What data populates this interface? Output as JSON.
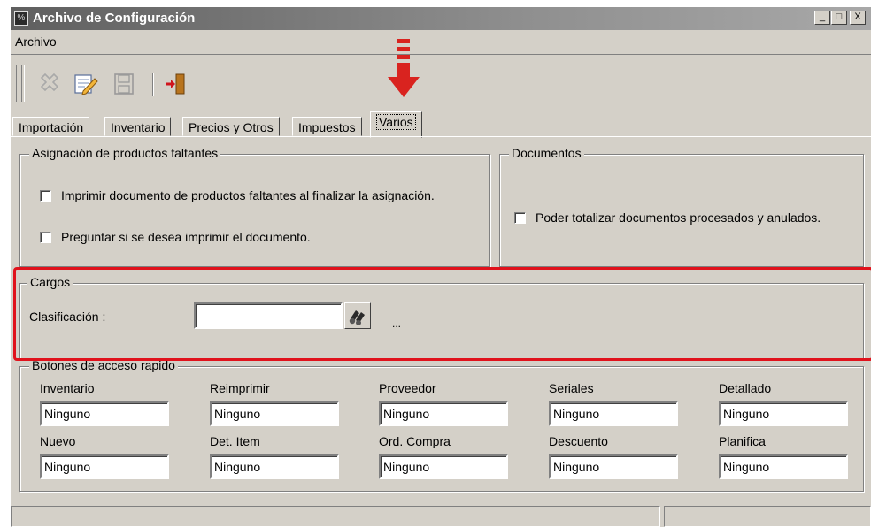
{
  "window": {
    "title": "Archivo de Configuración",
    "icon": "app-icon",
    "controls": {
      "minimize": "_",
      "maximize": "□",
      "close": "X"
    }
  },
  "menubar": {
    "items": [
      "Archivo"
    ]
  },
  "toolbar": {
    "buttons": [
      {
        "name": "delete-icon",
        "enabled": false
      },
      {
        "name": "edit-icon",
        "enabled": true
      },
      {
        "name": "save-icon",
        "enabled": false
      },
      {
        "name": "exit-icon",
        "enabled": true
      }
    ]
  },
  "annotation": {
    "arrow_color": "#d9231f",
    "highlight_color": "#e0121c"
  },
  "tabs": {
    "items": [
      "Importación",
      "Inventario",
      "Precios y Otros",
      "Impuestos",
      "Varios"
    ],
    "active": "Varios"
  },
  "asignacion": {
    "title": "Asignación de productos faltantes",
    "options": [
      {
        "label": "Imprimir documento de productos faltantes al finalizar la asignación.",
        "checked": false
      },
      {
        "label": "Preguntar si se desea imprimir el documento.",
        "checked": false
      }
    ]
  },
  "documentos": {
    "title": "Documentos",
    "options": [
      {
        "label": "Poder totalizar documentos procesados y anulados.",
        "checked": false
      }
    ]
  },
  "cargos": {
    "title": "Cargos",
    "clasificacion_label": "Clasificación :",
    "clasificacion_value": "",
    "ellipsis": "..."
  },
  "botones": {
    "title": "Botones de acceso rapido",
    "fields": [
      {
        "label": "Inventario",
        "value": "Ninguno"
      },
      {
        "label": "Reimprimir",
        "value": "Ninguno"
      },
      {
        "label": "Proveedor",
        "value": "Ninguno"
      },
      {
        "label": "Seriales",
        "value": "Ninguno"
      },
      {
        "label": "Detallado",
        "value": "Ninguno"
      },
      {
        "label": "Nuevo",
        "value": "Ninguno"
      },
      {
        "label": "Det. Item",
        "value": "Ninguno"
      },
      {
        "label": "Ord. Compra",
        "value": "Ninguno"
      },
      {
        "label": "Descuento",
        "value": "Ninguno"
      },
      {
        "label": "Planifica",
        "value": "Ninguno"
      }
    ]
  }
}
